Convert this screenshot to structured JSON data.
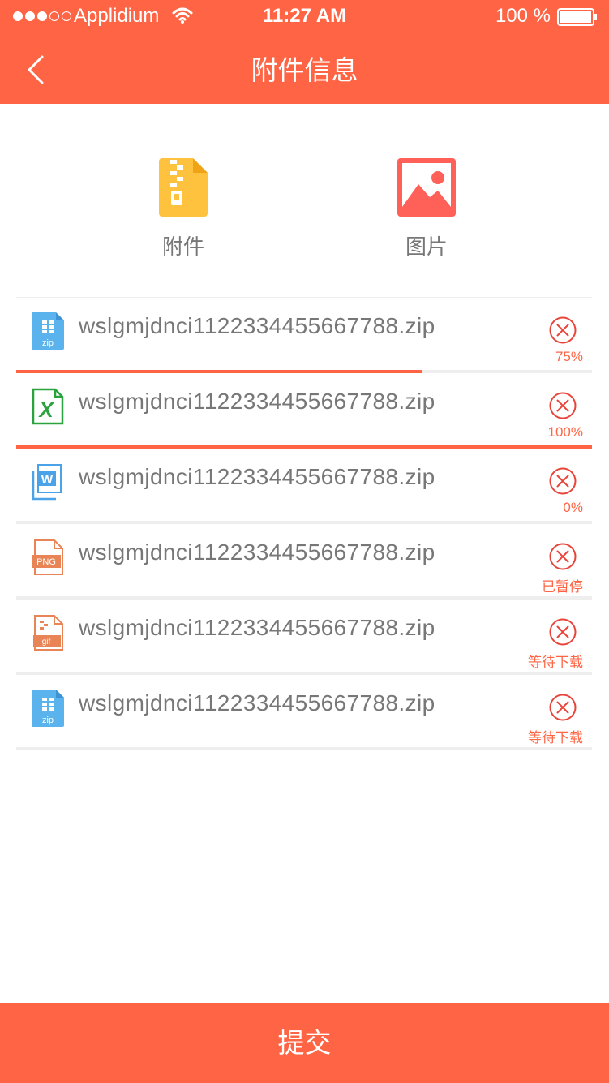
{
  "status_bar": {
    "carrier": "Applidium",
    "time": "11:27 AM",
    "battery": "100 %"
  },
  "header": {
    "title": "附件信息"
  },
  "tabs": [
    {
      "label": "附件"
    },
    {
      "label": "图片"
    }
  ],
  "files": [
    {
      "name": "wslgmjdnci1122334455667788.zip",
      "type": "zip",
      "status": "75%",
      "progress": 0.705
    },
    {
      "name": "wslgmjdnci1122334455667788.zip",
      "type": "excel",
      "status": "100%",
      "progress": 1.0
    },
    {
      "name": "wslgmjdnci1122334455667788.zip",
      "type": "word",
      "status": "0%",
      "progress": 0
    },
    {
      "name": "wslgmjdnci1122334455667788.zip",
      "type": "png",
      "status": "已暂停",
      "progress": 0
    },
    {
      "name": "wslgmjdnci1122334455667788.zip",
      "type": "gif",
      "status": "等待下载",
      "progress": 0
    },
    {
      "name": "wslgmjdnci1122334455667788.zip",
      "type": "zip",
      "status": "等待下载",
      "progress": 0
    }
  ],
  "submit": {
    "label": "提交"
  },
  "colors": {
    "accent": "#ff6444",
    "remove_icon": "#e8443a"
  }
}
